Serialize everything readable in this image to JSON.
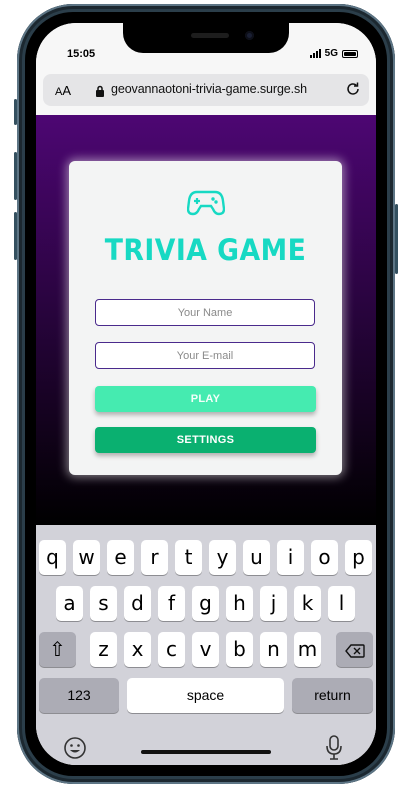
{
  "status_bar": {
    "time": "15:05",
    "network": "5G"
  },
  "browser": {
    "text_size_label_small": "A",
    "text_size_label_big": "A",
    "url": "geovannaotoni-trivia-game.surge.sh"
  },
  "app": {
    "title": "TRIVIA GAME",
    "logo_icon": "gamepad-icon",
    "name_input": {
      "placeholder": "Your Name",
      "value": ""
    },
    "email_input": {
      "placeholder": "Your E-mail",
      "value": ""
    },
    "play_label": "PLAY",
    "settings_label": "SETTINGS",
    "colors": {
      "title": "#17d9c3",
      "play": "#45ebb0",
      "settings": "#0ab070",
      "background_top": "#4d0673",
      "background_bottom": "#000000",
      "input_border": "#4a2a8c"
    }
  },
  "keyboard": {
    "row1": [
      "q",
      "w",
      "e",
      "r",
      "t",
      "y",
      "u",
      "i",
      "o",
      "p"
    ],
    "row2": [
      "a",
      "s",
      "d",
      "f",
      "g",
      "h",
      "j",
      "k",
      "l"
    ],
    "row3": [
      "z",
      "x",
      "c",
      "v",
      "b",
      "n",
      "m"
    ],
    "shift_glyph": "⇧",
    "numbers_label": "123",
    "space_label": "space",
    "return_label": "return",
    "emoji_icon": "emoji-icon",
    "mic_icon": "microphone-icon",
    "backspace_icon": "backspace-icon"
  }
}
